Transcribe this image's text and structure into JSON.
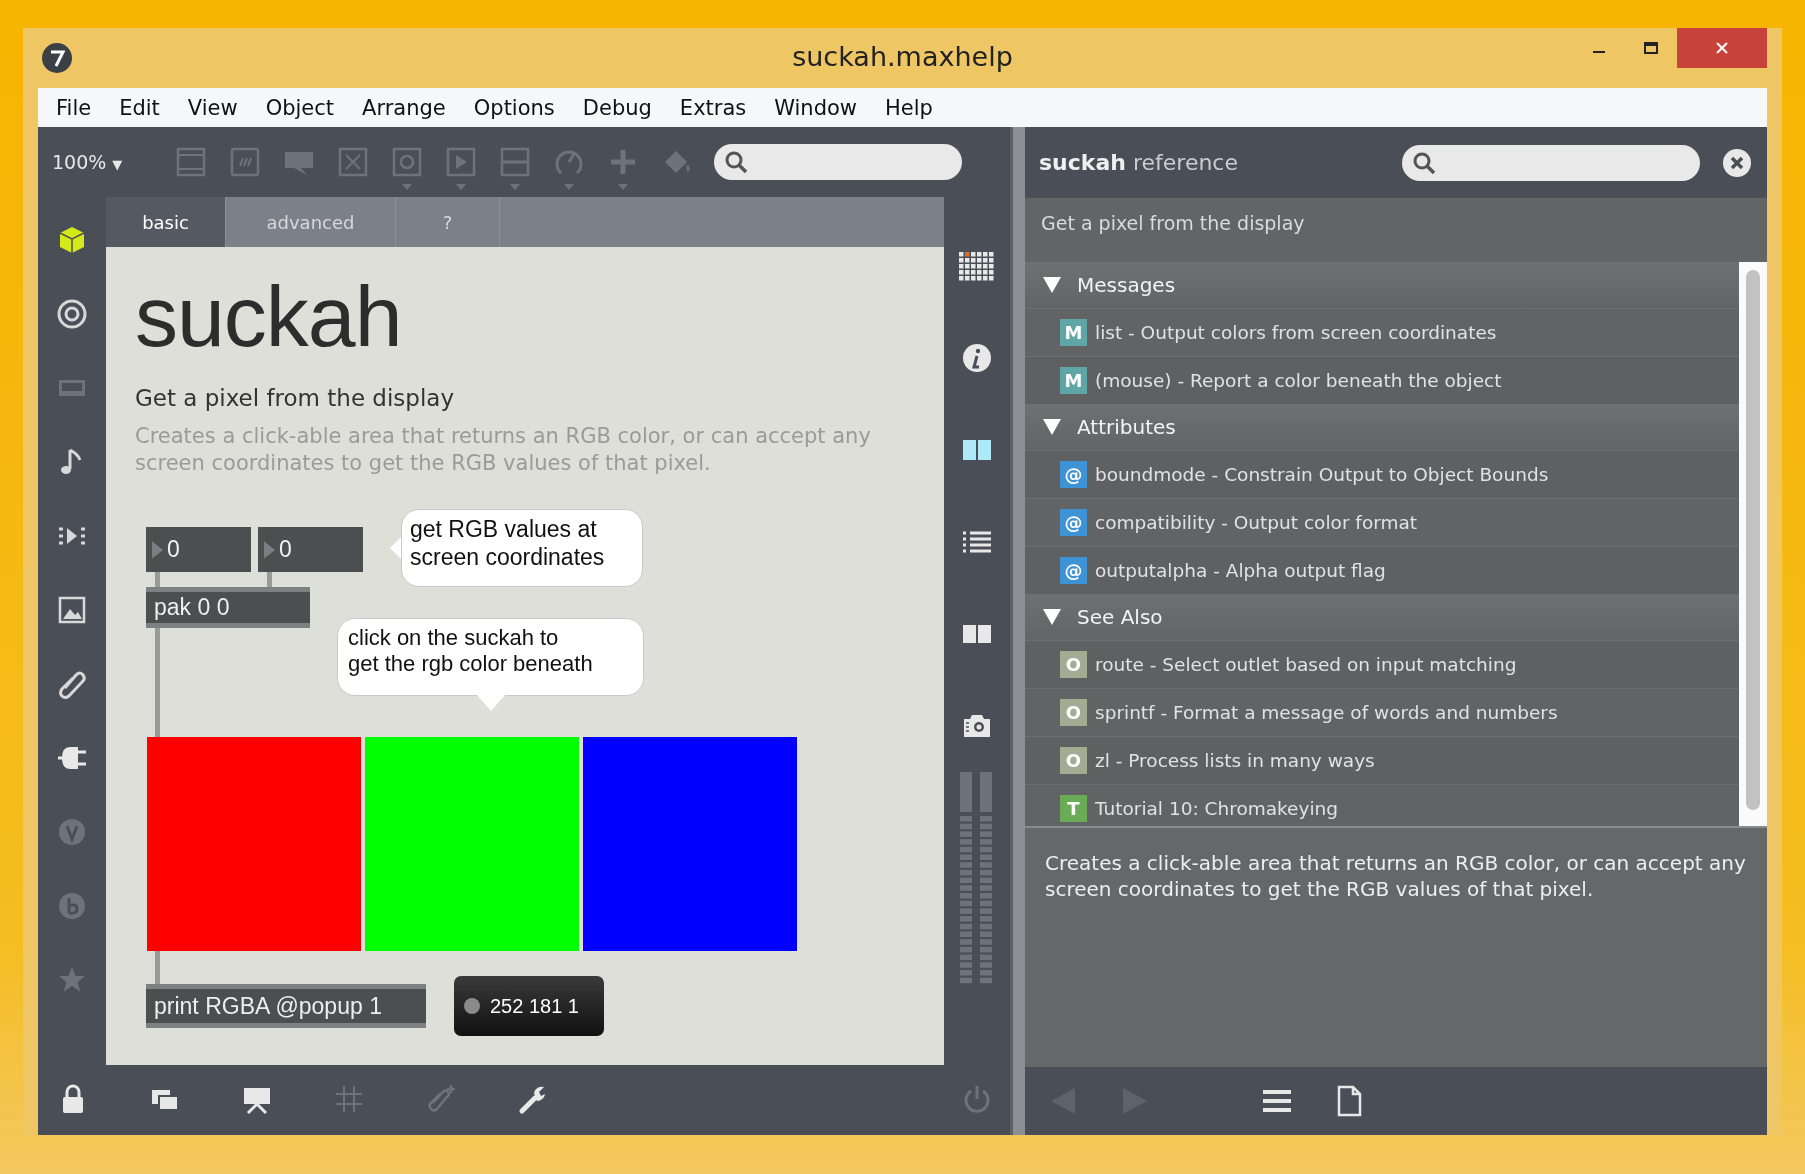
{
  "window": {
    "title": "suckah.maxhelp"
  },
  "menu": [
    "File",
    "Edit",
    "View",
    "Object",
    "Arrange",
    "Options",
    "Debug",
    "Extras",
    "Window",
    "Help"
  ],
  "toolbar": {
    "zoom": "100%",
    "zoom_caret": "▼"
  },
  "tabs": [
    {
      "label": "basic",
      "selected": true
    },
    {
      "label": "advanced",
      "selected": false
    },
    {
      "label": "?",
      "selected": false
    }
  ],
  "patch": {
    "title": "suckah",
    "subtitle": "Get a pixel from the display",
    "description": "Creates a click-able area that returns an RGB color, or can accept any screen coordinates to get the RGB values of that pixel.",
    "number_boxes": [
      "0",
      "0"
    ],
    "pack_object": "pak 0 0",
    "comments": [
      "get RGB values at\nscreen coordinates",
      "click on the suckah to\nget the rgb color beneath"
    ],
    "panels": [
      {
        "color": "#ff0000"
      },
      {
        "color": "#00ff00"
      },
      {
        "color": "#0000ff"
      }
    ],
    "print_object": "print RGBA @popup 1",
    "popup": "252 181 1"
  },
  "reference": {
    "name": "suckah",
    "label": "reference",
    "summary": "Get a pixel from the display",
    "sections": [
      {
        "title": "Messages",
        "expanded": true,
        "items": [
          {
            "kind": "message",
            "badge": "M",
            "text": "list - Output colors from screen coordinates"
          },
          {
            "kind": "message",
            "badge": "M",
            "text": "(mouse) - Report a color beneath the object"
          }
        ]
      },
      {
        "title": "Attributes",
        "expanded": true,
        "items": [
          {
            "kind": "attribute",
            "badge": "@",
            "text": "boundmode - Constrain Output to Object Bounds"
          },
          {
            "kind": "attribute",
            "badge": "@",
            "text": "compatibility - Output color format"
          },
          {
            "kind": "attribute",
            "badge": "@",
            "text": "outputalpha - Alpha output flag"
          }
        ]
      },
      {
        "title": "See Also",
        "expanded": true,
        "items": [
          {
            "kind": "object",
            "badge": "O",
            "text": "route - Select outlet based on input matching"
          },
          {
            "kind": "object",
            "badge": "O",
            "text": "sprintf - Format a message of words and numbers"
          },
          {
            "kind": "object",
            "badge": "O",
            "text": "zl - Process lists in many ways"
          },
          {
            "kind": "tutorial",
            "badge": "T",
            "text": "Tutorial 10: Chromakeying"
          }
        ]
      }
    ],
    "description": "Creates a click-able area that returns an RGB color, or can accept any screen coordinates to get the RGB values of that pixel."
  }
}
